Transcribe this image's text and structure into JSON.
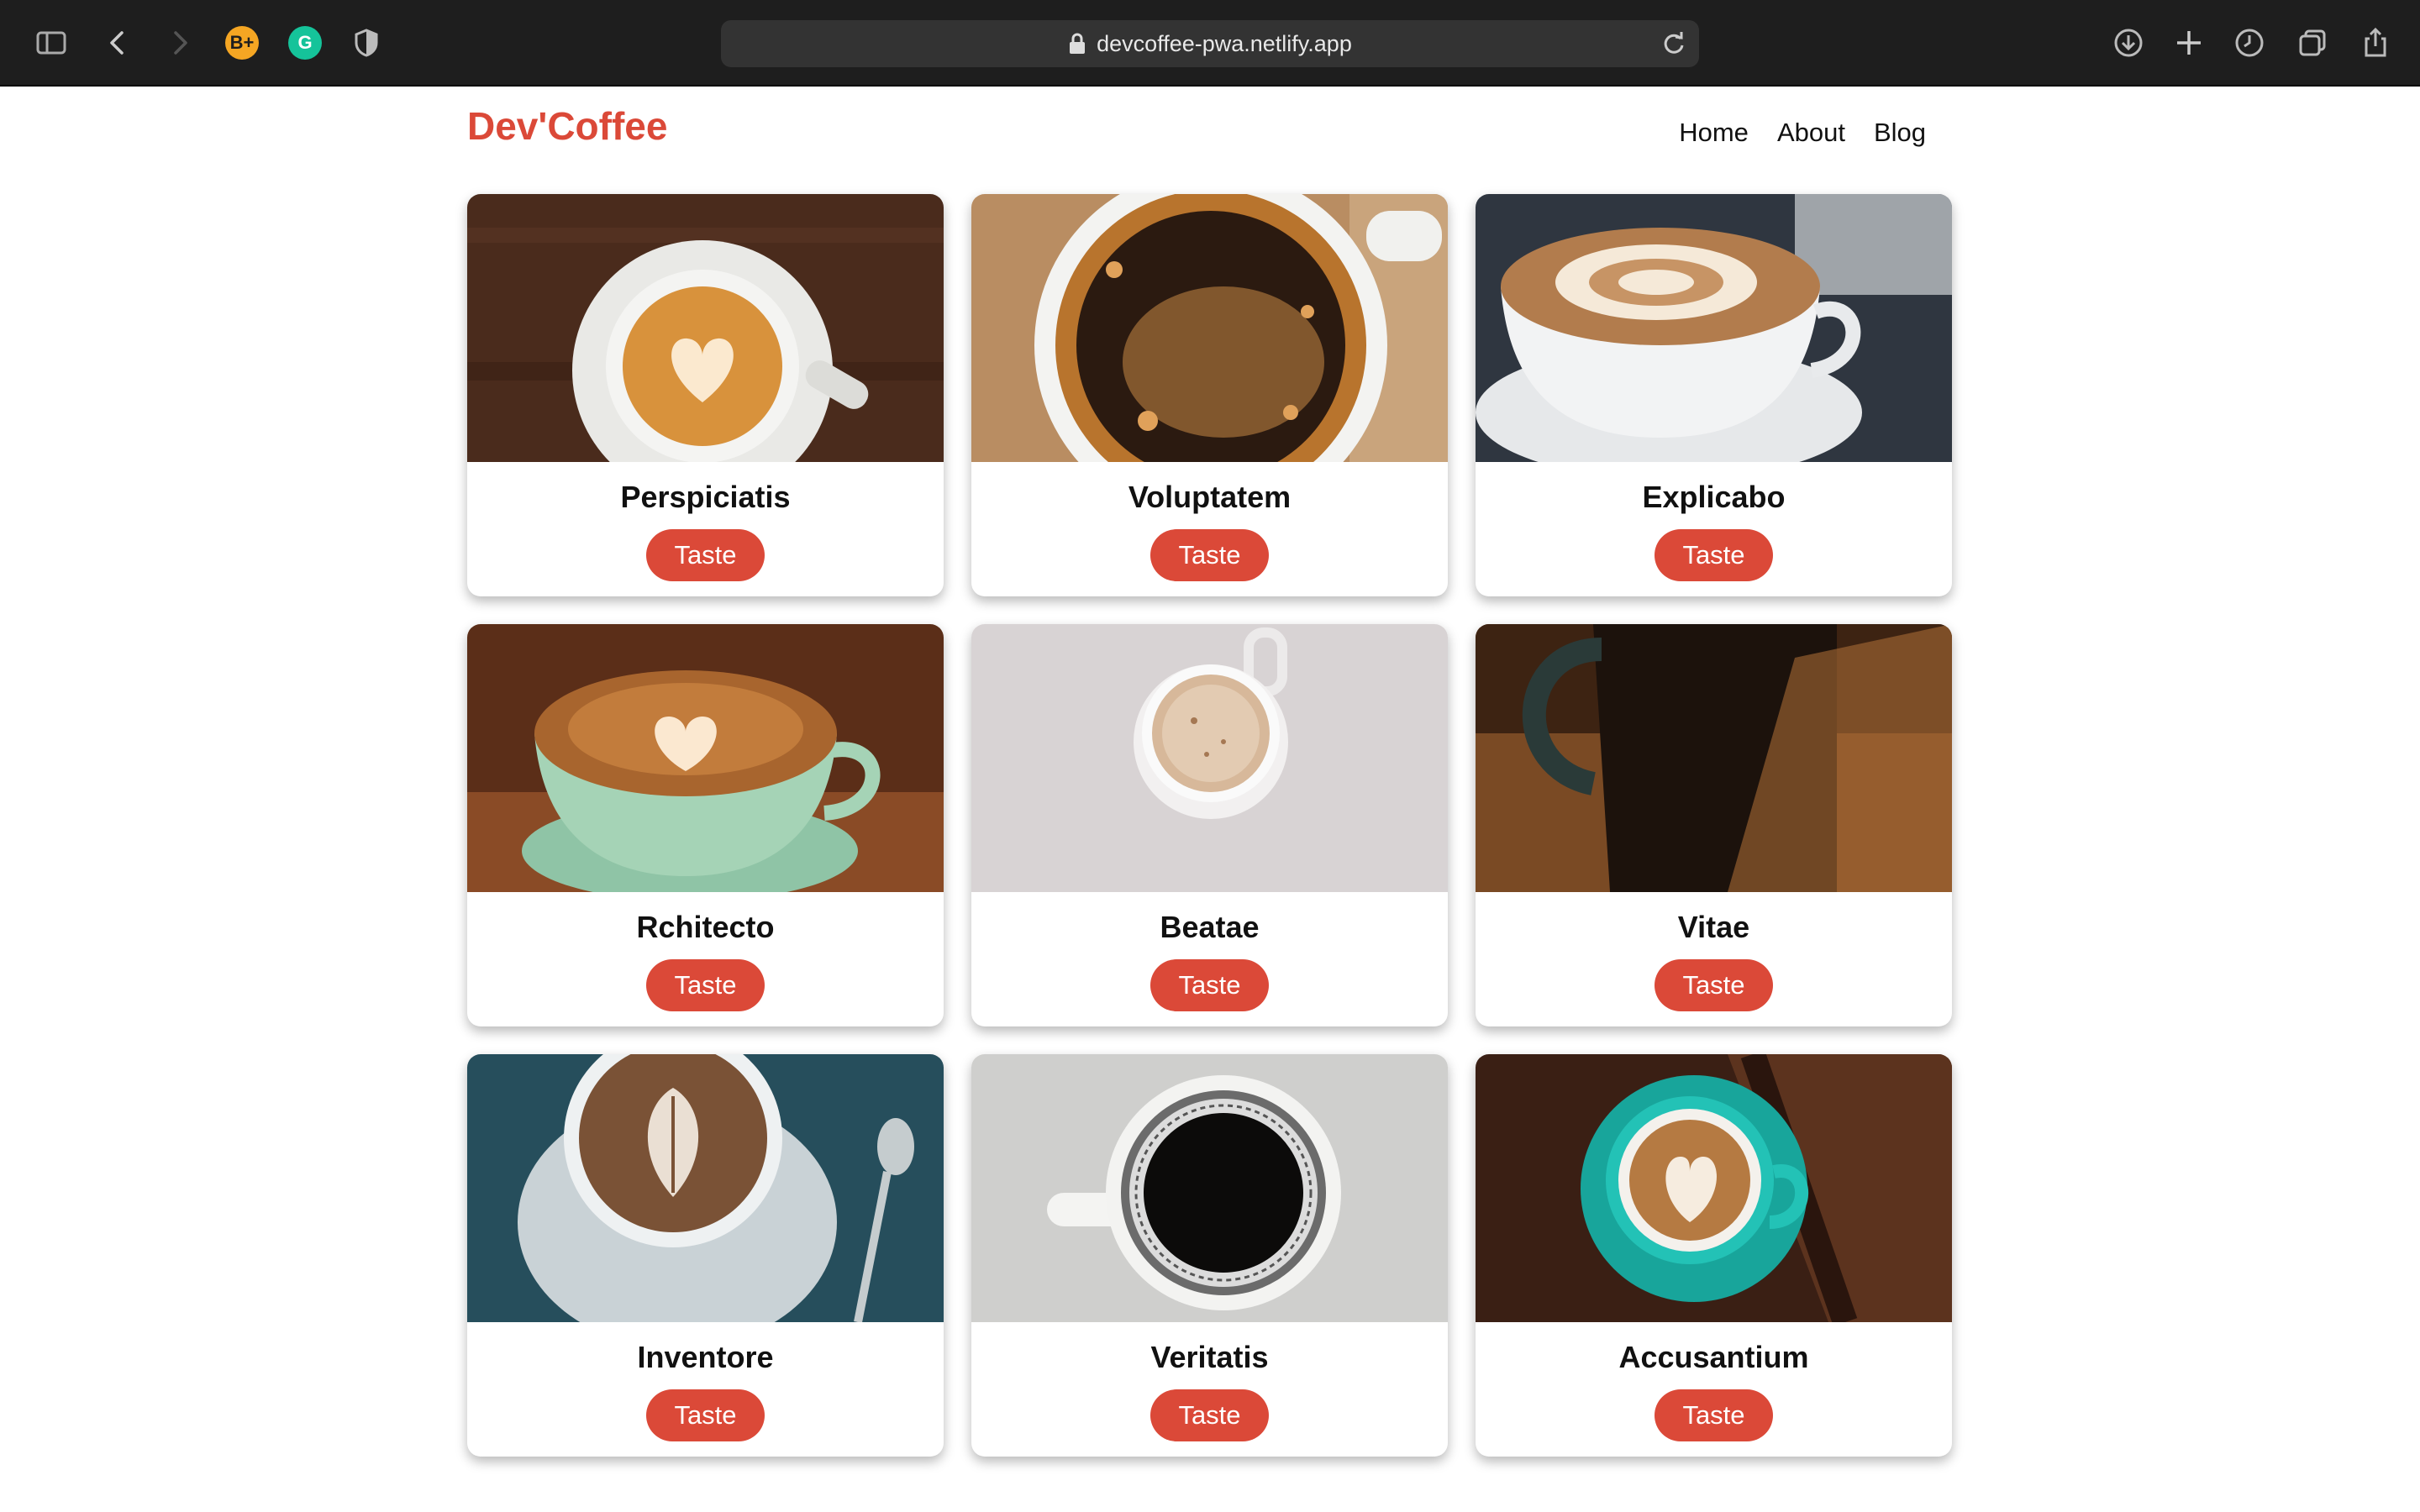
{
  "browser": {
    "url": "devcoffee-pwa.netlify.app",
    "extensions": [
      {
        "name": "bplus-extension-icon",
        "label": "B+",
        "color": "#f5a623"
      },
      {
        "name": "grammarly-icon",
        "label": "G",
        "color": "#15c39a"
      }
    ]
  },
  "site": {
    "brand": "Dev'Coffee",
    "nav": [
      "Home",
      "About",
      "Blog"
    ],
    "accent": "#db4938"
  },
  "coffees": [
    {
      "name": "Perspiciatis",
      "button": "Taste",
      "photo": "latte-heart-on-dark-wood"
    },
    {
      "name": "Voluptatem",
      "button": "Taste",
      "photo": "black-coffee-foam-closeup"
    },
    {
      "name": "Explicabo",
      "button": "Taste",
      "photo": "latte-art-white-cup"
    },
    {
      "name": "Rchitecto",
      "button": "Taste",
      "photo": "latte-heart-green-cup"
    },
    {
      "name": "Beatae",
      "button": "Taste",
      "photo": "small-cup-on-white"
    },
    {
      "name": "Vitae",
      "button": "Taste",
      "photo": "dark-mug-on-table"
    },
    {
      "name": "Inventore",
      "button": "Taste",
      "photo": "cappuccino-with-spoon"
    },
    {
      "name": "Veritatis",
      "button": "Taste",
      "photo": "black-coffee-printed-cup"
    },
    {
      "name": "Accusantium",
      "button": "Taste",
      "photo": "latte-teal-cup"
    }
  ]
}
